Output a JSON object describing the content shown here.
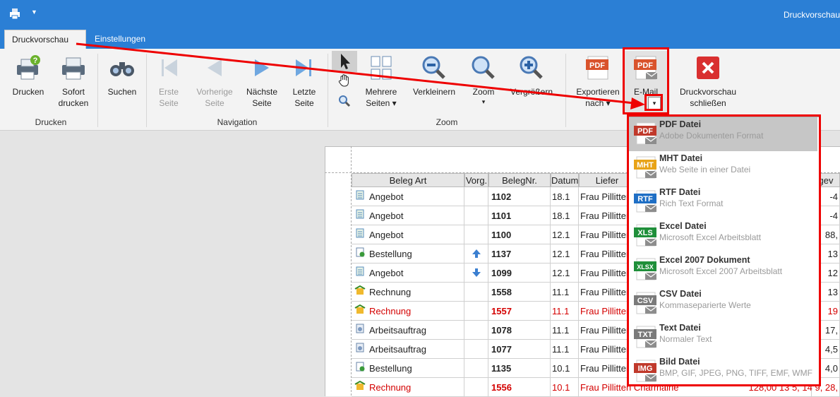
{
  "window": {
    "title": "Druckvorschau"
  },
  "tabs": {
    "print_preview": "Druckvorschau",
    "settings": "Einstellungen"
  },
  "ribbon": {
    "print": "Drucken",
    "instant_print": [
      "Sofort",
      "drucken"
    ],
    "search": "Suchen",
    "first_page": [
      "Erste",
      "Seite"
    ],
    "prev_page": [
      "Vorherige",
      "Seite"
    ],
    "next_page": [
      "Nächste",
      "Seite"
    ],
    "last_page": [
      "Letzte",
      "Seite"
    ],
    "multi_pages": [
      "Mehrere",
      "Seiten"
    ],
    "zoom_out": "Verkleinern",
    "zoom": "Zoom",
    "zoom_in": "Vergrößern",
    "export_to": [
      "Exportieren",
      "nach"
    ],
    "email": "E-Mail",
    "close_preview": [
      "Druckvorschau",
      "schließen"
    ],
    "group_print": "Drucken",
    "group_navigation": "Navigation",
    "group_zoom": "Zoom"
  },
  "table": {
    "headers": [
      "Beleg Art",
      "Vorg.",
      "BelegNr.",
      "Datum",
      "Liefer"
    ],
    "header_right": "gev",
    "rows": [
      {
        "type": "Angebot",
        "nr": "1102",
        "date": "18.1",
        "customer": "Frau Pillitter",
        "right": "-4",
        "red": false
      },
      {
        "type": "Angebot",
        "nr": "1101",
        "date": "18.1",
        "customer": "Frau Pillitter",
        "right": "-4",
        "red": false
      },
      {
        "type": "Angebot",
        "nr": "1100",
        "date": "12.1",
        "customer": "Frau Pillitter",
        "right": "88,",
        "red": false
      },
      {
        "type": "Bestellung",
        "nr": "1137",
        "date": "12.1",
        "customer": "Frau Pillitter",
        "right": "13",
        "red": false
      },
      {
        "type": "Angebot",
        "nr": "1099",
        "date": "12.1",
        "customer": "Frau Pillitter",
        "right": "12",
        "red": false
      },
      {
        "type": "Rechnung",
        "nr": "1558",
        "date": "11.1",
        "customer": "Frau Pillitter",
        "right": "13",
        "red": false
      },
      {
        "type": "Rechnung",
        "nr": "1557",
        "date": "11.1",
        "customer": "Frau Pillitter",
        "right": "19",
        "red": true
      },
      {
        "type": "Arbeitsauftrag",
        "nr": "1078",
        "date": "11.1",
        "customer": "Frau Pillitter",
        "right": "17,",
        "red": false
      },
      {
        "type": "Arbeitsauftrag",
        "nr": "1077",
        "date": "11.1",
        "customer": "Frau Pillitter",
        "right": "4,5",
        "red": false
      },
      {
        "type": "Bestellung",
        "nr": "1135",
        "date": "10.1",
        "customer": "Frau Pillitter",
        "right": "4,0",
        "red": false
      },
      {
        "type": "Rechnung",
        "nr": "1556",
        "date": "10.1",
        "customer": "Frau Pillitten Charmaine",
        "right": "128,00   13   5,   14   9,  28,",
        "red": true
      }
    ]
  },
  "email_menu": {
    "items": [
      {
        "badge": "PDF",
        "badge_color": "#c0392b",
        "title": "PDF Datei",
        "subtitle": "Adobe Dokumenten Format"
      },
      {
        "badge": "MHT",
        "badge_color": "#e8a317",
        "title": "MHT Datei",
        "subtitle": "Web Seite in einer Datei"
      },
      {
        "badge": "RTF",
        "badge_color": "#1f6fc5",
        "title": "RTF Datei",
        "subtitle": "Rich Text Format"
      },
      {
        "badge": "XLS",
        "badge_color": "#1f8f3a",
        "title": "Excel Datei",
        "subtitle": "Microsoft Excel Arbeitsblatt"
      },
      {
        "badge": "XLSX",
        "badge_color": "#1f8f3a",
        "title": "Excel 2007 Dokument",
        "subtitle": "Microsoft Excel 2007 Arbeitsblatt"
      },
      {
        "badge": "CSV",
        "badge_color": "#7a7a7a",
        "title": "CSV Datei",
        "subtitle": "Kommaseparierte Werte"
      },
      {
        "badge": "TXT",
        "badge_color": "#7a7a7a",
        "title": "Text Datei",
        "subtitle": "Normaler Text"
      },
      {
        "badge": "IMG",
        "badge_color": "#c0392b",
        "title": "Bild Datei",
        "subtitle": "BMP, GIF, JPEG, PNG, TIFF, EMF, WMF"
      }
    ]
  },
  "colors": {
    "titlebar": "#2b7fd5",
    "highlight": "#ee0000",
    "red_text": "#d40000"
  }
}
